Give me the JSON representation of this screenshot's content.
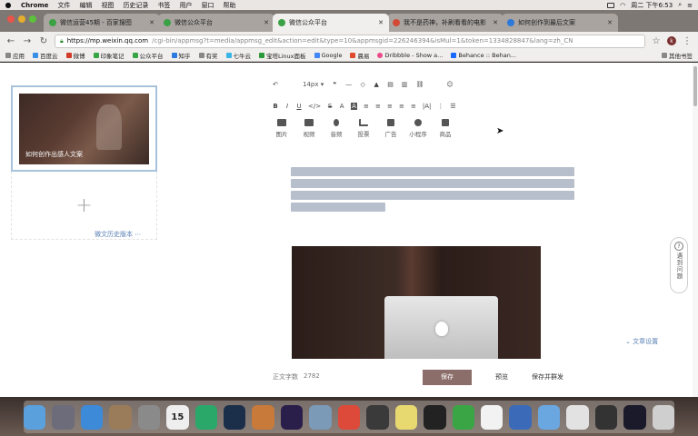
{
  "menubar": {
    "app_name": "Chrome",
    "menus": [
      "文件",
      "编辑",
      "视图",
      "历史记录",
      "书签",
      "用户",
      "窗口",
      "帮助"
    ],
    "clock": "周二 下午6:53"
  },
  "tabs": [
    {
      "label": "微信运营45期 - 百家搜图",
      "favicon": "green"
    },
    {
      "label": "微信公众平台",
      "favicon": "green"
    },
    {
      "label": "微信公众平台",
      "favicon": "green",
      "active": true
    },
    {
      "label": "我不是药神，补刷看看的电影",
      "favicon": "red"
    },
    {
      "label": "如何创作到最后文案",
      "favicon": "blue"
    }
  ],
  "browser": {
    "url_host": "https://mp.weixin.qq.com",
    "url_rest": "/cgi-bin/appmsg?t=media/appmsg_edit&action=edit&type=10&appmsgid=226246394&isMul=1&token=1334828847&lang=zh_CN",
    "profile_initial": "k"
  },
  "bookmarks": [
    "应用",
    "百度云",
    "微博",
    "印象笔记",
    "公众平台",
    "知乎",
    "有奖",
    "七牛云",
    "宝塔Linux面板",
    "Google",
    "晨易",
    "Dribbble - Show a...",
    "Behance :: Behan..."
  ],
  "bookmarks_other": "其他书签",
  "left_panel": {
    "article_title": "如何创作出感人文案",
    "add_symbol": "+",
    "history_link": "微文历史版本"
  },
  "editor": {
    "undo_icon": "↶",
    "font_size": "14px",
    "format_row1": [
      "❝",
      "—",
      "◇",
      "▲",
      "▤",
      "▥",
      "⛓",
      "☺"
    ],
    "format_row2": [
      "B",
      "I",
      "U",
      "</>",
      "S",
      "A",
      "A",
      "≡",
      "≡",
      "≡",
      "≡",
      "≡",
      "|A|",
      "⋮",
      "☰"
    ],
    "insert_tools": [
      "图片",
      "视频",
      "音频",
      "投票",
      "广告",
      "小程序",
      "商品"
    ],
    "word_count_label": "正文字数",
    "word_count": "2782",
    "save_label": "保存",
    "preview_label": "预览",
    "publish_label": "保存并群发",
    "settings_label": "文章设置"
  },
  "help_widget": {
    "icon": "?",
    "text": "遇到问题"
  },
  "dock": {
    "calendar_date": "15",
    "apps": [
      {
        "name": "finder",
        "color": "#5aa0dc"
      },
      {
        "name": "launchpad",
        "color": "#6c6c7a"
      },
      {
        "name": "app-store",
        "color": "#3c8ad8"
      },
      {
        "name": "preview",
        "color": "#9a7c5a"
      },
      {
        "name": "system-prefs",
        "color": "#8a8a8a"
      },
      {
        "name": "calendar",
        "color": "#eeeeee"
      },
      {
        "name": "grammarly",
        "color": "#2aa86a"
      },
      {
        "name": "photoshop",
        "color": "#1c2f4a"
      },
      {
        "name": "pages",
        "color": "#c87a3a"
      },
      {
        "name": "premiere",
        "color": "#2a1e4a"
      },
      {
        "name": "xcode",
        "color": "#7a9ab8"
      },
      {
        "name": "chrome",
        "color": "#dd4a3a"
      },
      {
        "name": "vectornator",
        "color": "#3a3a3a"
      },
      {
        "name": "notes",
        "color": "#e8d870"
      },
      {
        "name": "qq",
        "color": "#222222"
      },
      {
        "name": "wechat",
        "color": "#3aa545"
      },
      {
        "name": "texteditor",
        "color": "#f2f2f2"
      },
      {
        "name": "keynote",
        "color": "#3a6ab8"
      },
      {
        "name": "folder",
        "color": "#6aa6e0"
      },
      {
        "name": "coordinate",
        "color": "#e2e2e2"
      },
      {
        "name": "activity-monitor",
        "color": "#333333"
      },
      {
        "name": "quicktime",
        "color": "#1a1a2a"
      },
      {
        "name": "trash",
        "color": "#cfcfcf"
      }
    ]
  }
}
